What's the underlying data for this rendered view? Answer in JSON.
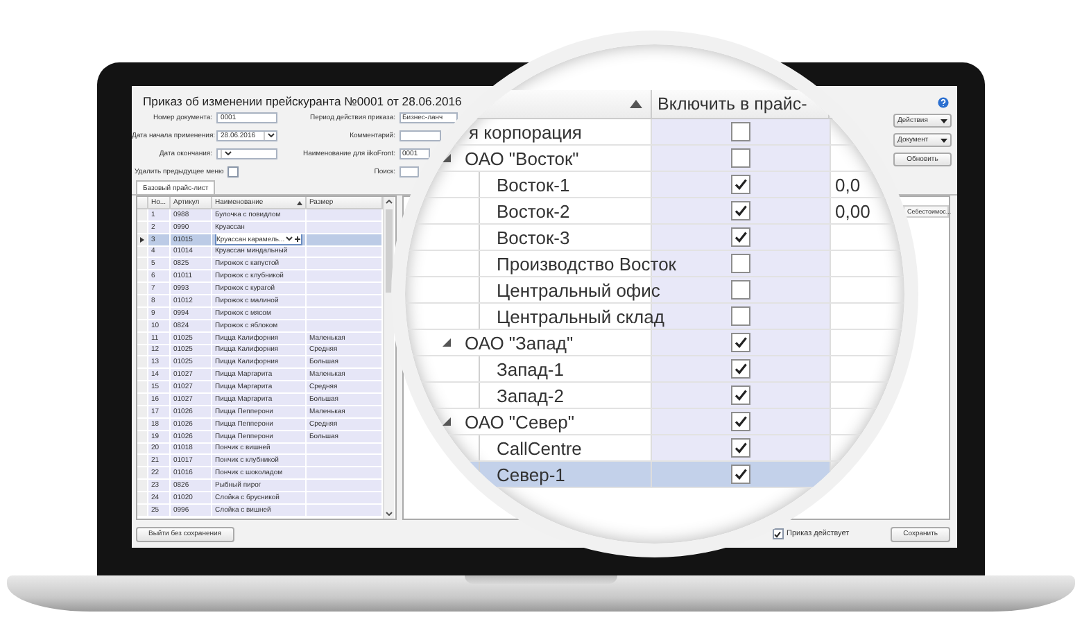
{
  "document": {
    "title": "Приказ об изменении прейскуранта №0001 от 28.06.2016",
    "fields": [
      {
        "kind": "text",
        "label": "Номер документа:",
        "value": "0001"
      },
      {
        "kind": "dropdown",
        "label": "Дата начала применения:",
        "value": "28.06.2016"
      },
      {
        "kind": "dropdown",
        "label": "Дата окончания:"
      },
      {
        "kind": "checkbox",
        "label": "Удалить предыдущее меню",
        "checked": false
      }
    ],
    "right_fields": [
      {
        "label": "Период действия приказа:",
        "value": "Бизнес-ланч"
      },
      {
        "label": "Комментарий:"
      },
      {
        "label": "Наименование для iikoFront:",
        "value": "0001"
      },
      {
        "label": "Поиск:"
      }
    ],
    "buttons": [
      {
        "kind": "menu",
        "label": "Действия"
      },
      {
        "kind": "menu",
        "label": "Документ"
      },
      {
        "kind": "plain",
        "label": "Обновить"
      }
    ]
  },
  "tabs": [
    {
      "label": "Базовый прайс-лист",
      "selected": true
    }
  ],
  "table": {
    "columns": [
      "Но...",
      "Артикул",
      "Наименование",
      "Размер"
    ],
    "rows": [
      {
        "number": "1",
        "article": "0988",
        "name": "Булочка с повидлом",
        "selected": false
      },
      {
        "number": "2",
        "article": "0990",
        "name": "Круассан",
        "selected": false
      },
      {
        "number": "3",
        "article": "01015",
        "name": "Круассан карамель...",
        "selected": true
      },
      {
        "number": "4",
        "article": "01014",
        "name": "Круассан миндальный",
        "selected": false
      },
      {
        "number": "5",
        "article": "0825",
        "name": "Пирожок с капустой",
        "selected": false
      },
      {
        "number": "6",
        "article": "01011",
        "name": "Пирожок с клубникой",
        "selected": false
      },
      {
        "number": "7",
        "article": "0993",
        "name": "Пирожок с курагой",
        "selected": false
      },
      {
        "number": "8",
        "article": "01012",
        "name": "Пирожок с малиной",
        "selected": false
      },
      {
        "number": "9",
        "article": "0994",
        "name": "Пирожок с мясом",
        "selected": false
      },
      {
        "number": "10",
        "article": "0824",
        "name": "Пирожок с яблоком",
        "selected": false
      },
      {
        "number": "11",
        "article": "01025",
        "name": "Пицца Калифорния",
        "size": "Маленькая",
        "selected": false
      },
      {
        "number": "12",
        "article": "01025",
        "name": "Пицца Калифорния",
        "size": "Средняя",
        "selected": false
      },
      {
        "number": "13",
        "article": "01025",
        "name": "Пицца Калифорния",
        "size": "Большая",
        "selected": false
      },
      {
        "number": "14",
        "article": "01027",
        "name": "Пицца Маргарита",
        "size": "Маленькая",
        "selected": false
      },
      {
        "number": "15",
        "article": "01027",
        "name": "Пицца Маргарита",
        "size": "Средняя",
        "selected": false
      },
      {
        "number": "16",
        "article": "01027",
        "name": "Пицца Маргарита",
        "size": "Большая",
        "selected": false
      },
      {
        "number": "17",
        "article": "01026",
        "name": "Пицца Пепперони",
        "size": "Маленькая",
        "selected": false
      },
      {
        "number": "18",
        "article": "01026",
        "name": "Пицца Пепперони",
        "size": "Средняя",
        "selected": false
      },
      {
        "number": "19",
        "article": "01026",
        "name": "Пицца Пепперони",
        "size": "Большая",
        "selected": false
      },
      {
        "number": "20",
        "article": "01018",
        "name": "Пончик с вишней",
        "selected": false
      },
      {
        "number": "21",
        "article": "01017",
        "name": "Пончик с клубникой",
        "selected": false
      },
      {
        "number": "22",
        "article": "01016",
        "name": "Пончик с шоколадом",
        "selected": false
      },
      {
        "number": "23",
        "article": "0826",
        "name": "Рыбный пирог",
        "selected": false
      },
      {
        "number": "24",
        "article": "01020",
        "name": "Слойка с брусникой",
        "selected": false
      },
      {
        "number": "25",
        "article": "0996",
        "name": "Слойка с вишней",
        "selected": false
      }
    ]
  },
  "right_table": {
    "columns": [
      "Себестоимос..."
    ]
  },
  "footer": {
    "exit_button": "Выйти без сохранения",
    "active_checkbox": {
      "label": "Приказ действует",
      "checked": true
    },
    "save_button": "Сохранить"
  },
  "magnifier": {
    "column_header": "Включить в прайс-",
    "tree": [
      {
        "label": "я корпорация",
        "checked": false,
        "selected": false,
        "children": [
          {
            "label": "ОАО \"Восток\"",
            "checked": false,
            "expanded": true,
            "selected": false,
            "children": [
              {
                "label": "Восток-1",
                "checked": true,
                "selected": false,
                "price": "0,0"
              },
              {
                "label": "Восток-2",
                "checked": true,
                "selected": false,
                "price": "0,00"
              },
              {
                "label": "Восток-3",
                "checked": true,
                "selected": false
              },
              {
                "label": "Производство Восток",
                "checked": false,
                "selected": false
              },
              {
                "label": "Центральный офис",
                "checked": false,
                "selected": false
              },
              {
                "label": "Центральный склад",
                "checked": false,
                "selected": false
              }
            ]
          },
          {
            "label": "ОАО \"Запад\"",
            "checked": true,
            "expanded": true,
            "selected": false,
            "children": [
              {
                "label": "Запад-1",
                "checked": true,
                "selected": false
              },
              {
                "label": "Запад-2",
                "checked": true,
                "selected": false
              }
            ]
          },
          {
            "label": "ОАО \"Север\"",
            "checked": true,
            "expanded": true,
            "selected": false,
            "children": [
              {
                "label": "CallCentre",
                "checked": true,
                "selected": false
              },
              {
                "label": "Север-1",
                "checked": true,
                "selected": true
              }
            ]
          }
        ]
      }
    ]
  }
}
